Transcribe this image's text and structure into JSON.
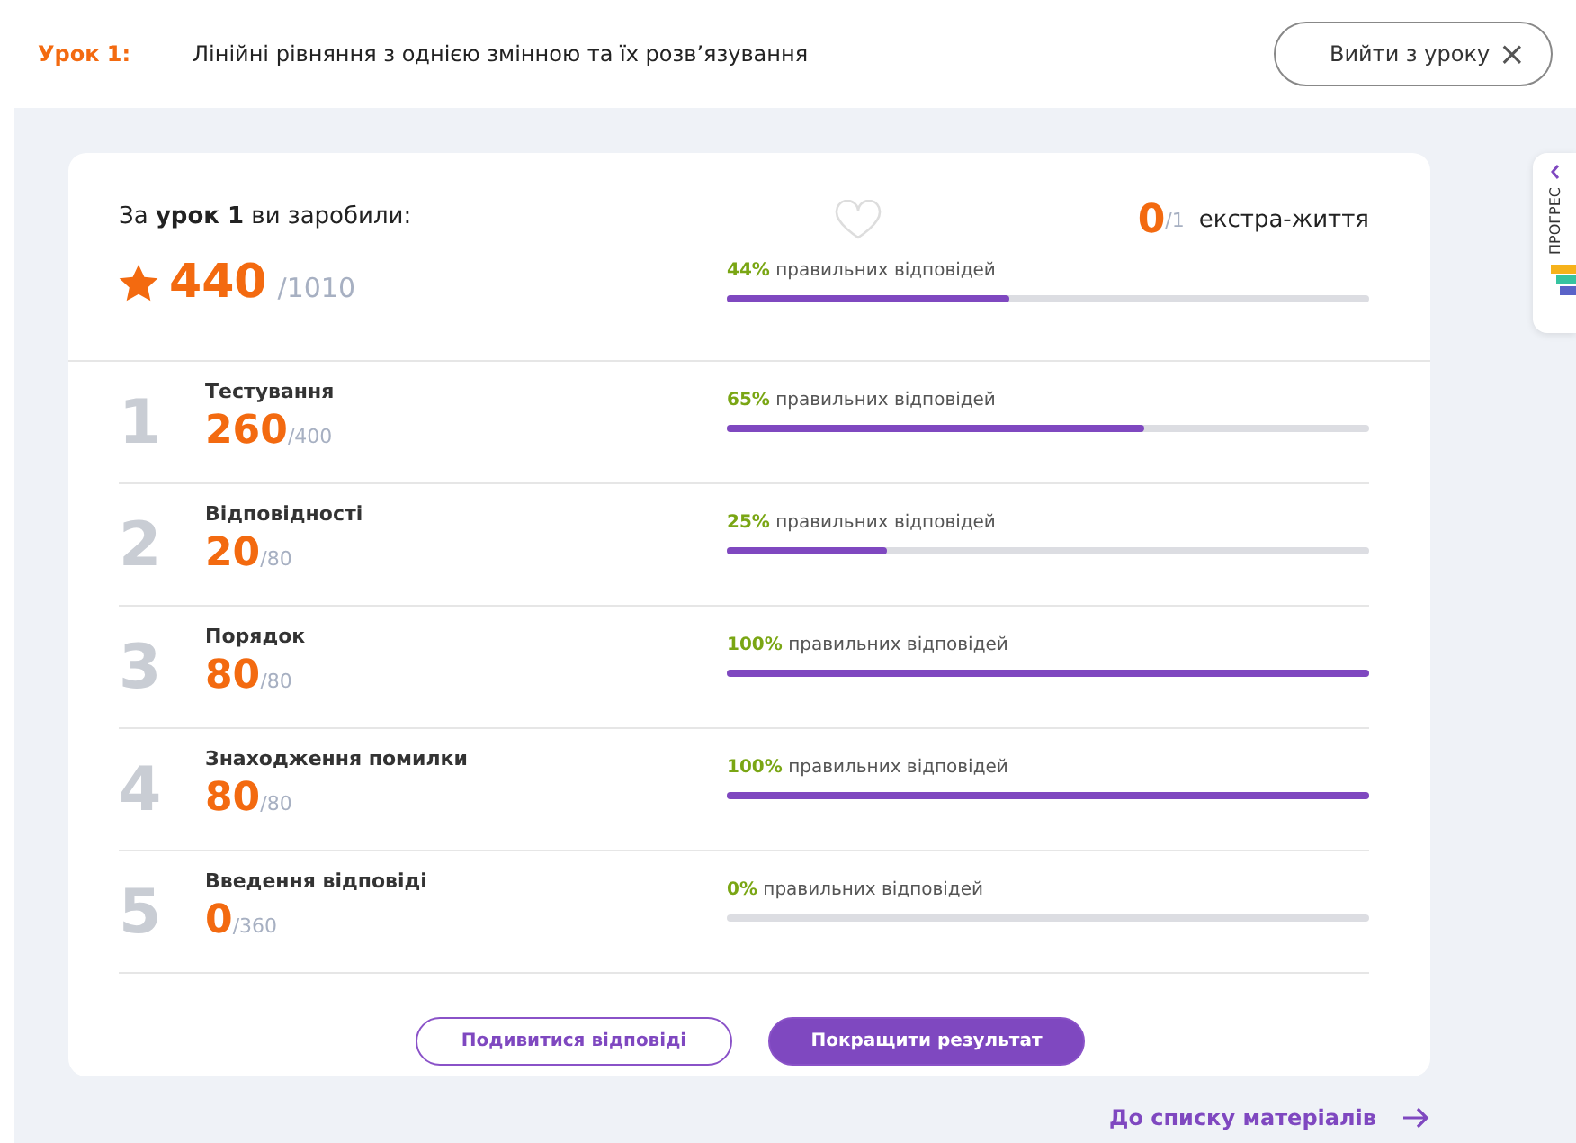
{
  "header": {
    "lesson_label": "Урок 1:",
    "lesson_title": "Лінійні рівняння з однією змінною та їх розв’язування",
    "exit_button": "Вийти з уроку",
    "close_glyph": "×"
  },
  "summary": {
    "intro": "За **урок 1** ви заробили:",
    "score": "440",
    "total": "/1010",
    "lives": "0",
    "lives_total": "/1",
    "lives_label": "екстра-життя",
    "percent": "44%",
    "percent_label": "правильних відповідей",
    "level": 0.44
  },
  "sections": [
    {
      "number": "1",
      "title": "Тестування",
      "score": "260",
      "total": "/400",
      "percent": "65%",
      "percent_label": "правильних відповідей",
      "level": 0.65
    },
    {
      "number": "2",
      "title": "Відповідності",
      "score": "20",
      "total": "/80",
      "percent": "25%",
      "percent_label": "правильних відповідей",
      "level": 0.25
    },
    {
      "number": "3",
      "title": "Порядок",
      "score": "80",
      "total": "/80",
      "percent": "100%",
      "percent_label": "правильних відповідей",
      "level": 1
    },
    {
      "number": "4",
      "title": "Знаходження помилки",
      "score": "80",
      "total": "/80",
      "percent": "100%",
      "percent_label": "правильних відповідей",
      "level": 1
    },
    {
      "number": "5",
      "title": "Введення відповіді",
      "score": "0",
      "total": "/360",
      "percent": "0%",
      "percent_label": "правильних відповідей",
      "level": 0
    }
  ],
  "buttons": [
    {
      "label": "Подивитися відповіді",
      "kind": "outline"
    },
    {
      "label": "Покращити результат",
      "kind": "filled"
    }
  ],
  "materials_link": "До списку матеріалів",
  "progress_tab": "ПРОГРЕС"
}
